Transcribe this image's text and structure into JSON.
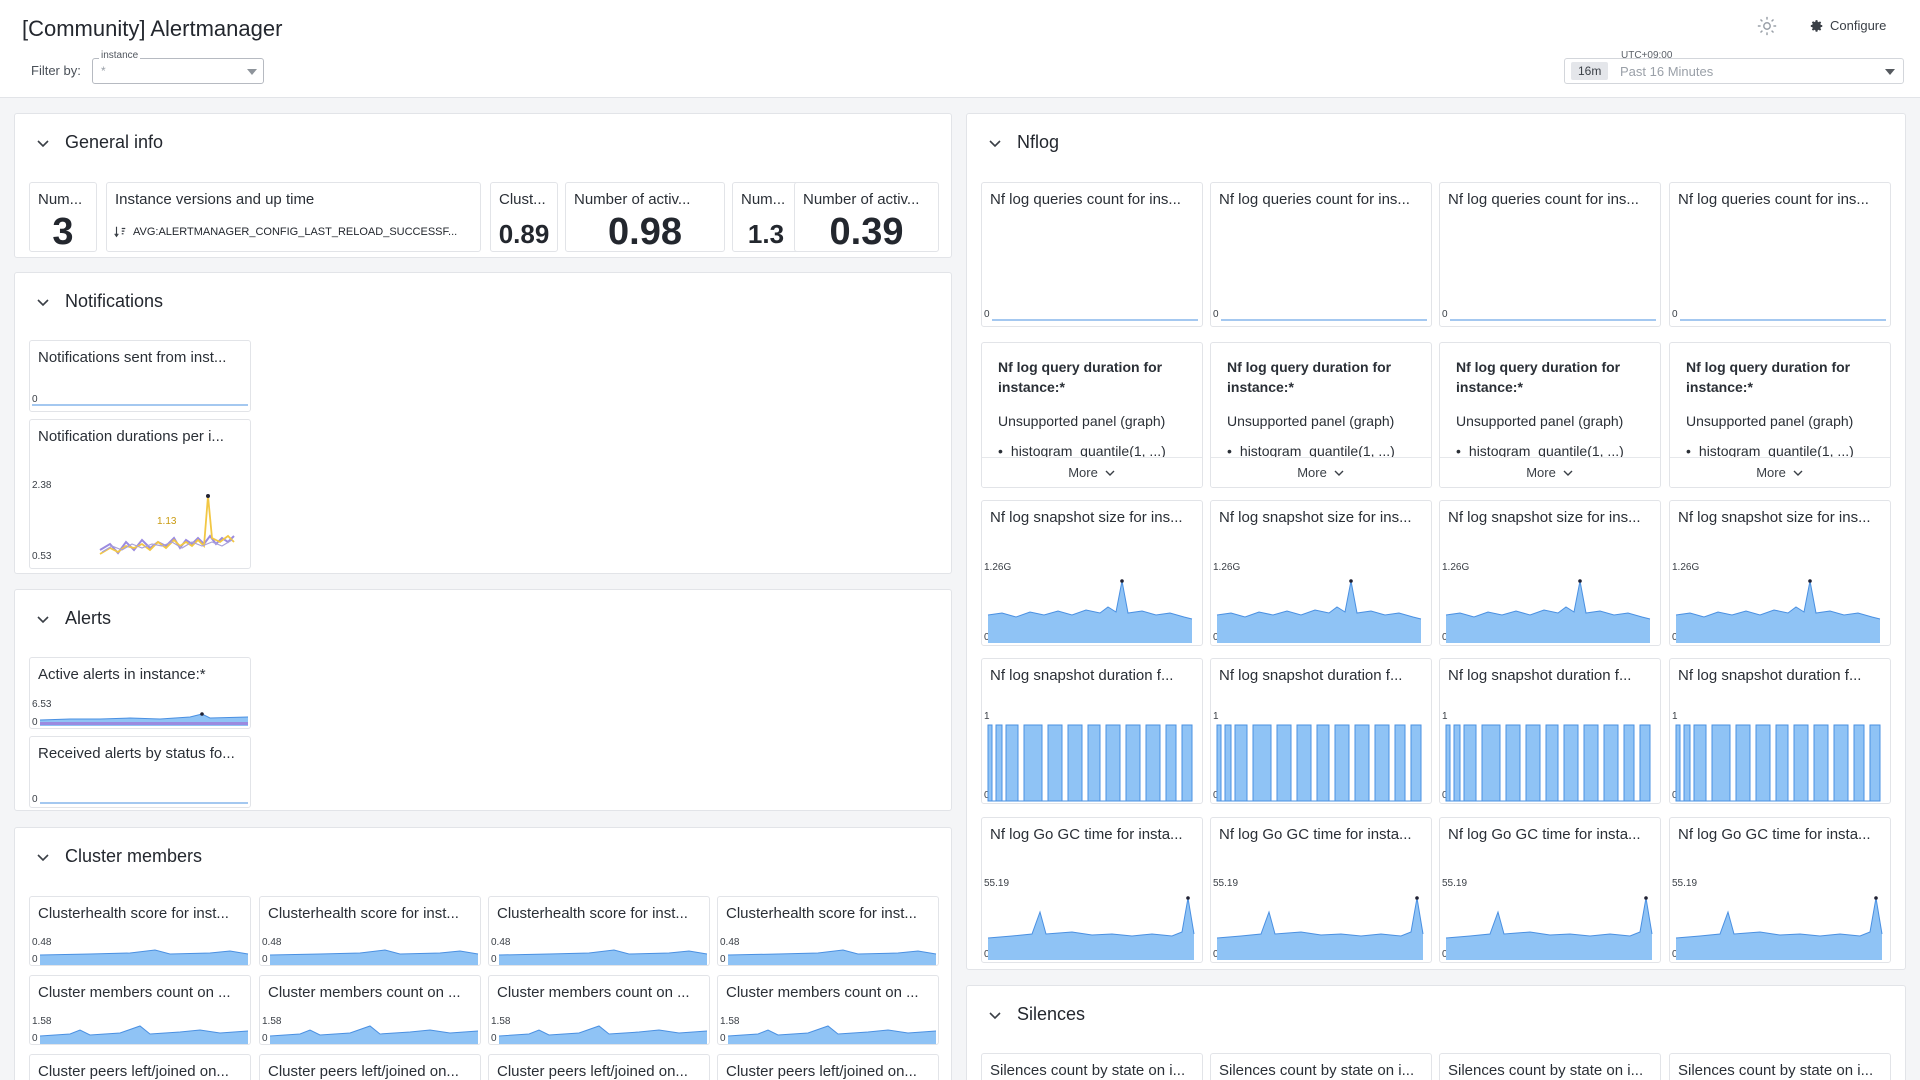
{
  "header": {
    "title": "[Community] Alertmanager",
    "filter_label": "Filter by:",
    "instance_label": "instance",
    "instance_value": "*",
    "configure_label": "Configure",
    "timezone": "UTC+09:00",
    "time_chip": "16m",
    "time_range": "Past 16 Minutes"
  },
  "icons": {
    "settings_top": "gear-icon",
    "configure": "gear-icon",
    "collapse": "chevron-down-icon",
    "sort": "sort-icon",
    "more": "chevron-down-icon"
  },
  "colors": {
    "area_fill": "#8fc3f5",
    "area_line": "#4a90e2",
    "yellow": "#f2c744",
    "purple": "#9b8be0"
  },
  "general_info": {
    "title": "General info",
    "tiles": [
      {
        "title": "Num...",
        "value": "3"
      },
      {
        "title": "Instance versions and up time",
        "value": "AVG:ALERTMANAGER_CONFIG_LAST_RELOAD_SUCCESSF..."
      },
      {
        "title": "Clust...",
        "value": "0.89"
      },
      {
        "title": "Number of activ...",
        "value": "0.98"
      },
      {
        "title": "Num...",
        "value": "1.3"
      },
      {
        "title": "Number of activ...",
        "value": "0.39"
      }
    ]
  },
  "notifications": {
    "title": "Notifications",
    "tiles": [
      {
        "title": "Notifications sent from inst...",
        "y_max": "",
        "y_min": "0"
      },
      {
        "title": "Notification durations per i...",
        "y_max": "2.38",
        "y_min": "0.53",
        "annotation": "1.13"
      }
    ]
  },
  "alerts": {
    "title": "Alerts",
    "tiles": [
      {
        "title": "Active alerts in instance:*",
        "y_max": "6.53",
        "y_min": "0"
      },
      {
        "title": "Received alerts by status fo...",
        "y_max": "",
        "y_min": "0"
      }
    ]
  },
  "cluster": {
    "title": "Cluster members",
    "health_title": "Clusterhealth score for inst...",
    "health_ymax": "0.48",
    "members_title": "Cluster members count on ...",
    "members_ymax": "1.58",
    "peers_title": "Cluster peers left/joined on...",
    "y_min": "0"
  },
  "nflog": {
    "title": "Nflog",
    "queries_title": "Nf log queries count for ins...",
    "duration_title": "Nf log query duration for instance:*",
    "unsupported": "Unsupported panel (graph)",
    "unsupported_item": "histogram_quantile(1, ...)",
    "more_label": "More",
    "snapshot_size_title": "Nf log snapshot size for ins...",
    "snapshot_size_ymax": "1.26G",
    "snapshot_duration_title": "Nf log snapshot duration f...",
    "snapshot_duration_ymax": "1",
    "gc_title": "Nf log Go GC time for insta...",
    "gc_ymax": "55.19",
    "y_min": "0"
  },
  "silences": {
    "title": "Silences",
    "tile_title": "Silences count by state on i..."
  }
}
